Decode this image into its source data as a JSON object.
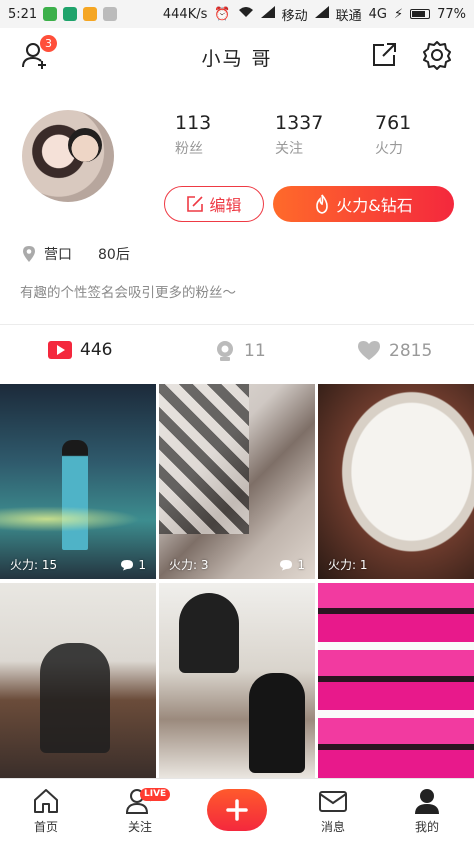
{
  "status_bar": {
    "time": "5:21",
    "network_speed": "444K/s",
    "carrier1": "移动",
    "carrier2": "联通",
    "network_type": "4G",
    "battery": "77%"
  },
  "header": {
    "title": "小马  哥",
    "notification_count": "3"
  },
  "profile": {
    "stats": [
      {
        "value": "113",
        "label": "粉丝"
      },
      {
        "value": "1337",
        "label": "关注"
      },
      {
        "value": "761",
        "label": "火力"
      }
    ],
    "edit_label": "编辑",
    "fire_label": "火力&钻石",
    "location": "营口",
    "age": "80后",
    "bio": "有趣的个性签名会吸引更多的粉丝～"
  },
  "tabs": [
    {
      "count": "446",
      "icon": "video-icon"
    },
    {
      "count": "11",
      "icon": "camera-icon"
    },
    {
      "count": "2815",
      "icon": "heart-icon"
    }
  ],
  "videos": [
    {
      "fire": "火力: 15",
      "comments": "1"
    },
    {
      "fire": "火力: 3",
      "comments": "1"
    },
    {
      "fire": "火力: 1",
      "comments": ""
    },
    {
      "fire": "",
      "comments": ""
    },
    {
      "fire": "",
      "comments": ""
    },
    {
      "fire": "",
      "comments": ""
    }
  ],
  "bottom_nav": {
    "home": "首页",
    "follow": "关注",
    "live": "LIVE",
    "messages": "消息",
    "me": "我的"
  },
  "colors": {
    "accent": "#f4283d",
    "accent_orange": "#ff6a2a"
  }
}
